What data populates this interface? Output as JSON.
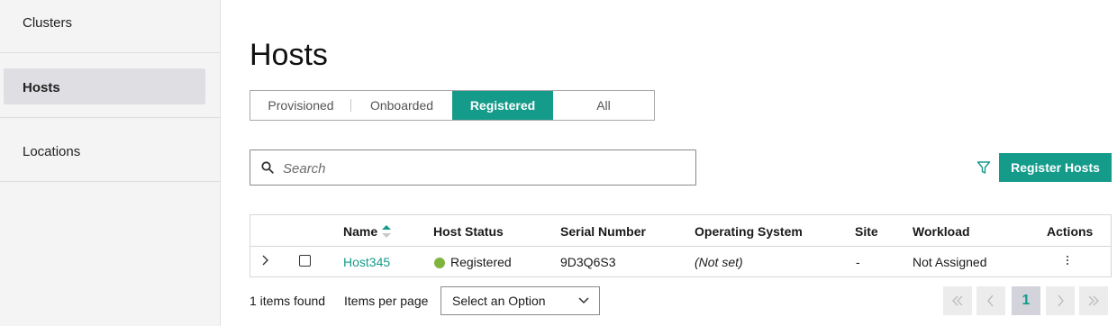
{
  "sidebar": {
    "items": [
      {
        "label": "Clusters",
        "active": false
      },
      {
        "label": "Hosts",
        "active": true
      },
      {
        "label": "Locations",
        "active": false
      }
    ]
  },
  "page": {
    "title": "Hosts"
  },
  "tabs": [
    "Provisioned",
    "Onboarded",
    "Registered",
    "All"
  ],
  "active_tab": "Registered",
  "search": {
    "placeholder": "Search",
    "value": ""
  },
  "toolbar": {
    "register_label": "Register Hosts",
    "filter_icon": "filter-icon"
  },
  "table": {
    "columns": [
      "Name",
      "Host Status",
      "Serial Number",
      "Operating System",
      "Site",
      "Workload",
      "Actions"
    ],
    "sorted_by": "Name",
    "rows": [
      {
        "name": "Host345",
        "status": "Registered",
        "status_color": "#7fb53f",
        "serial": "9D3Q6S3",
        "os": "(Not set)",
        "site": "-",
        "workload": "Not Assigned"
      }
    ]
  },
  "footer": {
    "items_found": "1 items found",
    "items_per_page_label": "Items per page",
    "items_per_page_value": "Select an Option",
    "current_page": "1"
  },
  "colors": {
    "accent": "#149b8a",
    "sidebar_bg": "#f4f4f4"
  }
}
